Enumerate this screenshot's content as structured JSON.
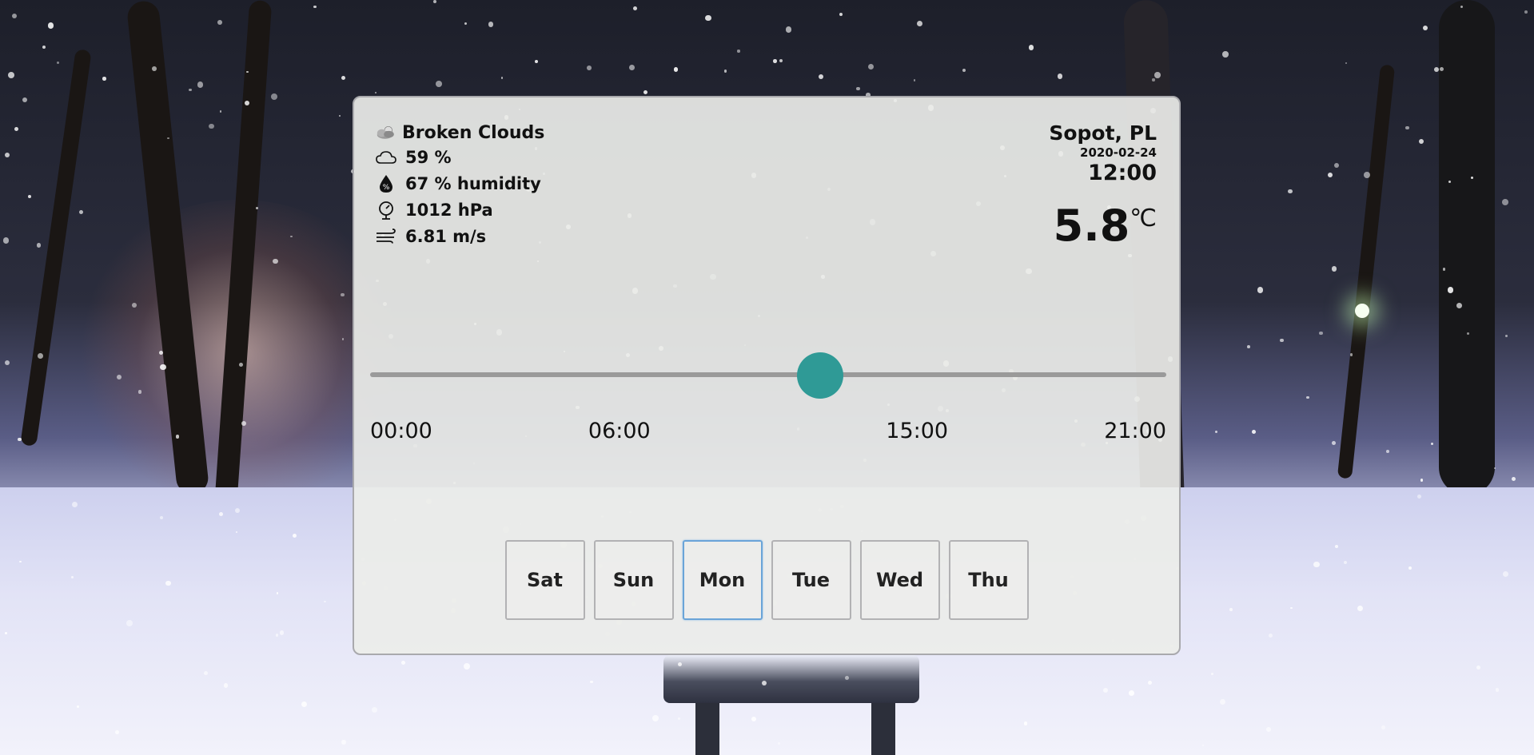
{
  "weather": {
    "condition": "Broken Clouds",
    "condition_icon": "cloud-sun-icon",
    "cloudiness": "59 %",
    "humidity": "67 % humidity",
    "pressure": "1012 hPa",
    "wind": "6.81 m/s"
  },
  "location": {
    "city": "Sopot, PL",
    "date": "2020-02-24",
    "time": "12:00"
  },
  "temperature": {
    "value": "5.8",
    "unit": "℃"
  },
  "timeline": {
    "value_fraction": 0.565,
    "ticks": [
      {
        "label": "00:00",
        "align": "left"
      },
      {
        "label": "06:00",
        "align": "left"
      },
      {
        "label": "15:00",
        "align": "right"
      },
      {
        "label": "21:00",
        "align": "right"
      }
    ]
  },
  "days": [
    {
      "label": "Sat",
      "active": false
    },
    {
      "label": "Sun",
      "active": false
    },
    {
      "label": "Mon",
      "active": true
    },
    {
      "label": "Tue",
      "active": false
    },
    {
      "label": "Wed",
      "active": false
    },
    {
      "label": "Thu",
      "active": false
    }
  ],
  "colors": {
    "accent": "#2f9a96",
    "active_border": "#6aa4d8"
  }
}
